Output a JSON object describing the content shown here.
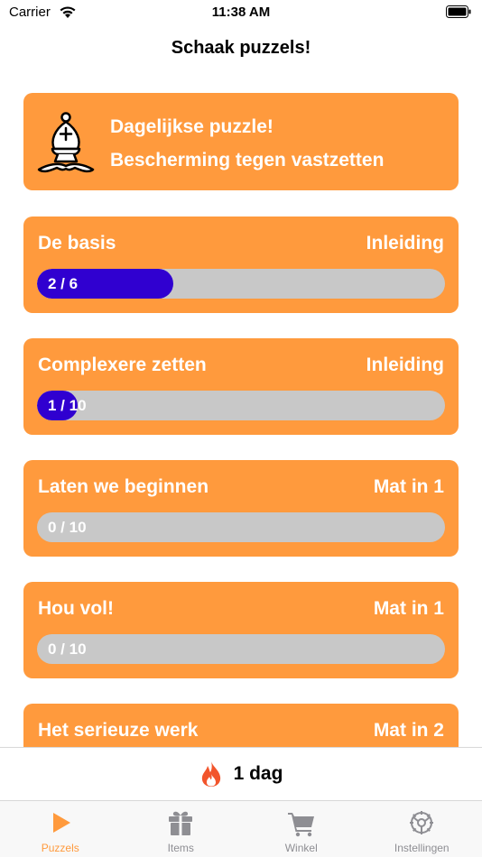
{
  "status_bar": {
    "carrier": "Carrier",
    "time": "11:38 AM"
  },
  "nav": {
    "title": "Schaak puzzels!"
  },
  "daily": {
    "line1": "Dagelijkse puzzle!",
    "line2": "Bescherming tegen vastzetten",
    "icon": "bishop-icon"
  },
  "courses": [
    {
      "title": "De basis",
      "category": "Inleiding",
      "progress_label": "2 / 6",
      "progress": 0.333
    },
    {
      "title": "Complexere zetten",
      "category": "Inleiding",
      "progress_label": "1 / 10",
      "progress": 0.1
    },
    {
      "title": "Laten we beginnen",
      "category": "Mat in 1",
      "progress_label": "0 / 10",
      "progress": 0
    },
    {
      "title": "Hou vol!",
      "category": "Mat in 1",
      "progress_label": "0 / 10",
      "progress": 0
    },
    {
      "title": "Het serieuze werk",
      "category": "Mat in 2",
      "progress_label": "",
      "progress": 0
    }
  ],
  "streak": {
    "text": "1 dag",
    "icon": "flame-icon"
  },
  "tabs": [
    {
      "label": "Puzzels",
      "icon": "play-icon",
      "active": true
    },
    {
      "label": "Items",
      "icon": "gift-icon",
      "active": false
    },
    {
      "label": "Winkel",
      "icon": "cart-icon",
      "active": false
    },
    {
      "label": "Instellingen",
      "icon": "gear-icon",
      "active": false
    }
  ],
  "colors": {
    "accent": "#ff9a3d",
    "progress_fill": "#3000d0",
    "track": "#c8c8c8",
    "inactive_tab": "#8e8e93",
    "flame": "#f2552c"
  }
}
